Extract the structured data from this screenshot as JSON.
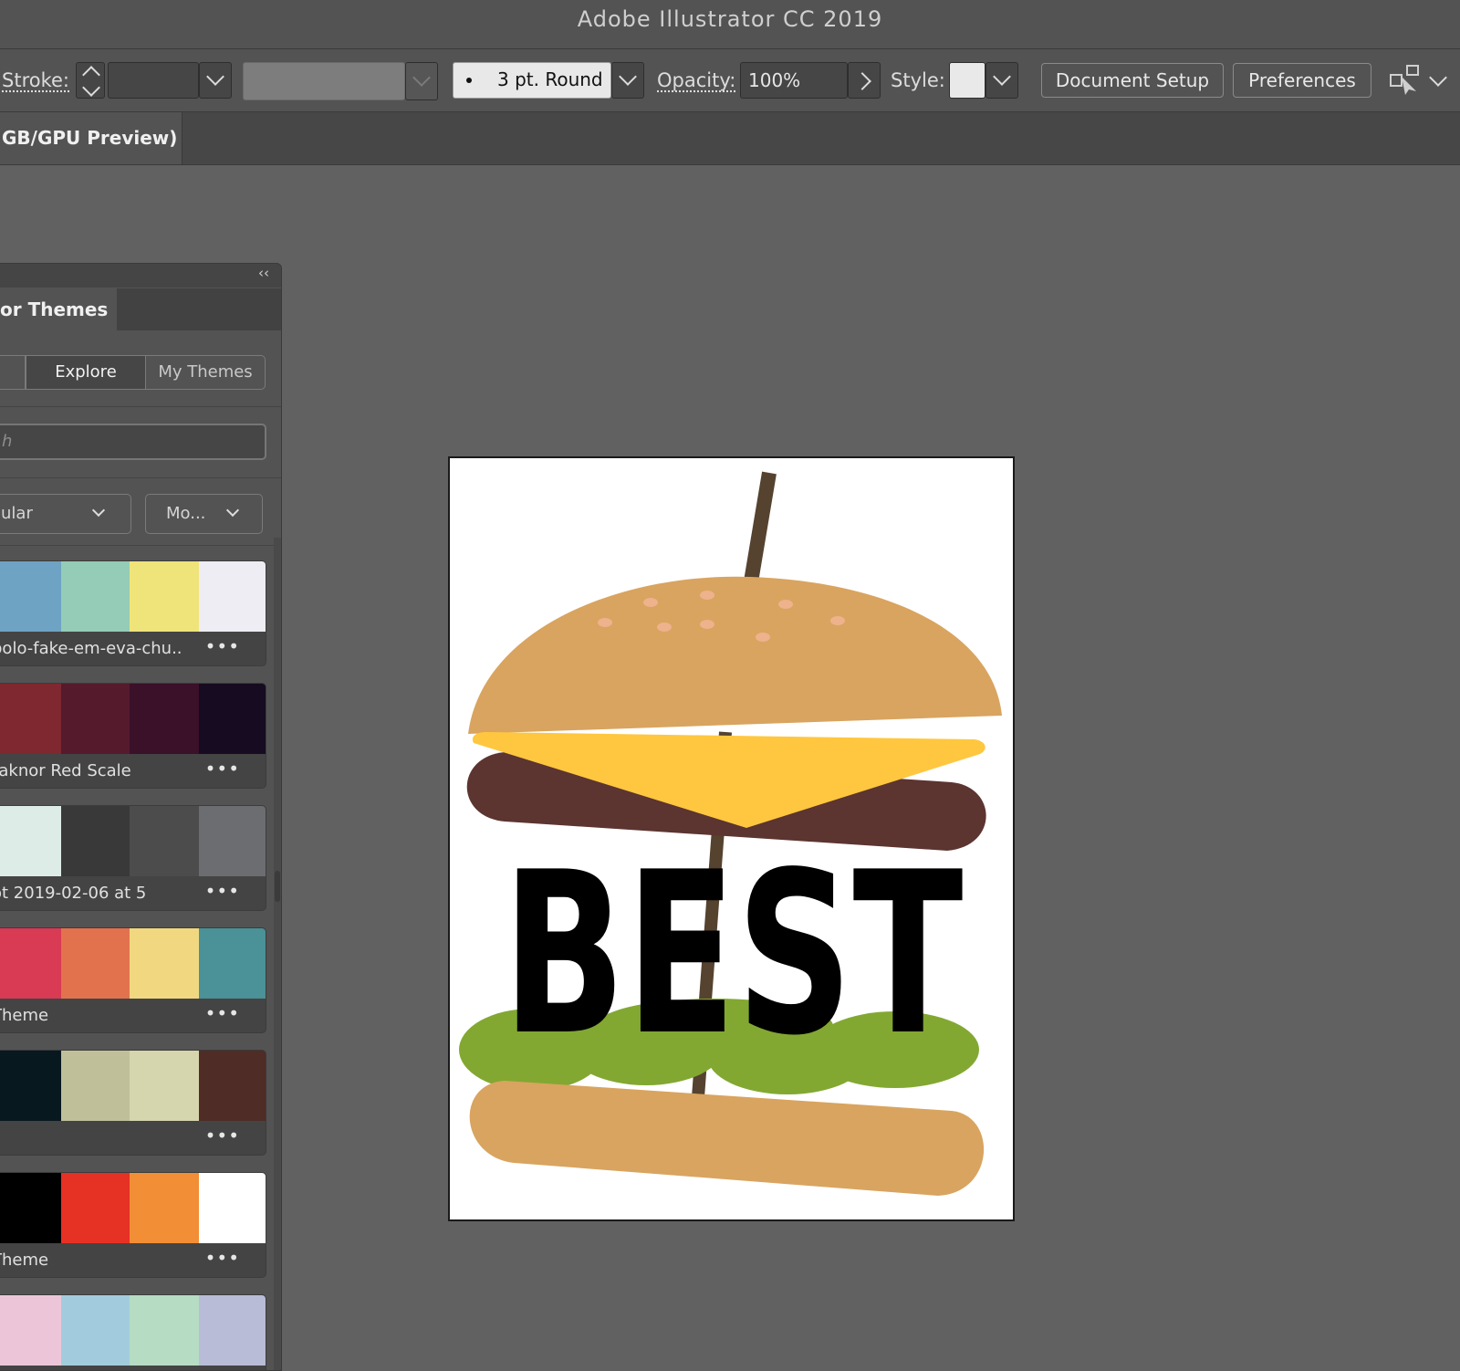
{
  "app": {
    "title": "Adobe Illustrator CC 2019"
  },
  "control_bar": {
    "stroke_label": "Stroke:",
    "stroke_width_value": "",
    "brush_profile": "3 pt. Round",
    "opacity_label": "Opacity:",
    "opacity_value": "100%",
    "style_label": "Style:",
    "document_setup": "Document Setup",
    "preferences": "Preferences"
  },
  "document_tab": {
    "label": "GB/GPU Preview)"
  },
  "panel": {
    "title": "or Themes",
    "segments": [
      "",
      "Explore",
      "My Themes"
    ],
    "search_placeholder": "h",
    "filter_sort": "ular",
    "filter_time": "Mo...",
    "more_glyph": "•••",
    "themes": [
      {
        "name": "polo-fake-em-eva-chu...",
        "colors": [
          "#6fa3c4",
          "#95ccb7",
          "#efe47a",
          "#eeedf3"
        ]
      },
      {
        "name": "raknor Red Scale",
        "colors": [
          "#7f2830",
          "#551a2c",
          "#3b1029",
          "#160b20"
        ]
      },
      {
        "name": "ot 2019-02-06 at 5",
        "colors": [
          "#deece7",
          "#393939",
          "#4c4c4c",
          "#6c6d70"
        ]
      },
      {
        "name": "Theme",
        "colors": [
          "#d93a54",
          "#e2724e",
          "#f1d880",
          "#4a9198"
        ]
      },
      {
        "name": "",
        "colors": [
          "#08181f",
          "#bfc09a",
          "#d5d5ae",
          "#4f2c25"
        ]
      },
      {
        "name": "Theme",
        "colors": [
          "#000000",
          "#e63125",
          "#f28e35",
          "#ffffff"
        ]
      },
      {
        "name": "",
        "colors": [
          "#ecc6d8",
          "#a2ccde",
          "#b6dcc3",
          "#b9bcd6"
        ]
      }
    ]
  },
  "artwork": {
    "text": "BEST",
    "colors": {
      "bun": "#d9a45f",
      "seeds": "#eeb28d",
      "cheese": "#ffc73f",
      "patty": "#5c3430",
      "lettuce": "#82a832",
      "stick": "#55422f",
      "text": "#000000"
    }
  }
}
